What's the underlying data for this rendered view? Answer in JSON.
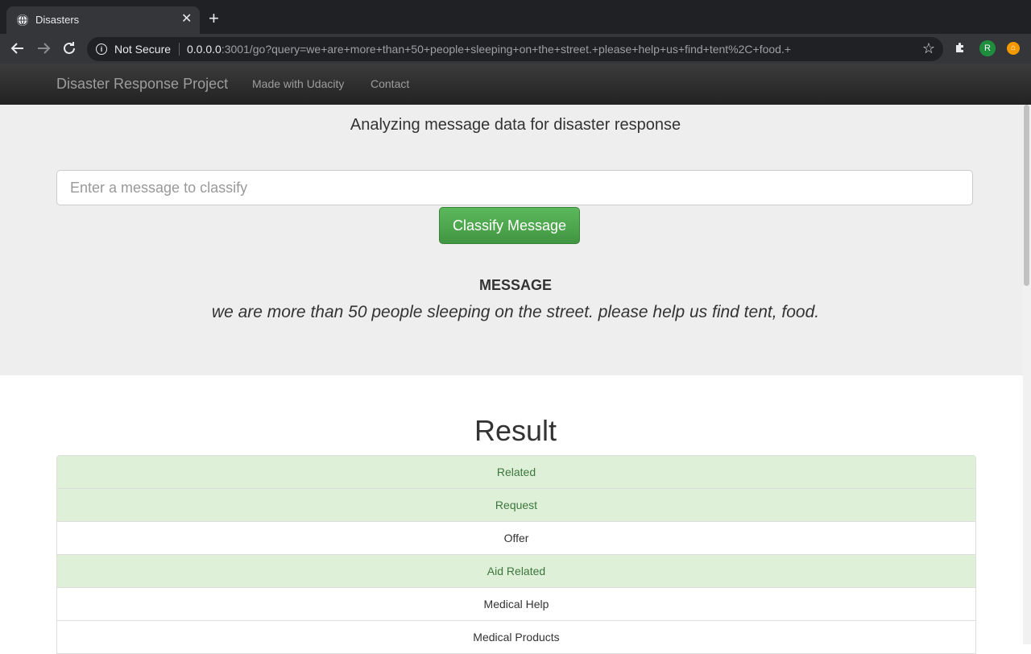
{
  "browser": {
    "tab_title": "Disasters",
    "tab_close": "✕",
    "new_tab": "+",
    "security_label": "Not Secure",
    "url_host": "0.0.0.0",
    "url_rest": ":3001/go?query=we+are+more+than+50+people+sleeping+on+the+street.+please+help+us+find+tent%2C+food.+",
    "profile_initial": "R",
    "icons": [
      "globe-icon",
      "back-icon",
      "forward-icon",
      "reload-icon",
      "info-icon",
      "star-icon",
      "extensions-icon",
      "profile-avatar",
      "extension-icon"
    ]
  },
  "navbar": {
    "brand": "Disaster Response Project",
    "links": [
      "Made with Udacity",
      "Contact"
    ]
  },
  "hero": {
    "subtitle": "Analyzing message data for disaster response",
    "input_placeholder": "Enter a message to classify",
    "input_value": "",
    "classify_label": "Classify Message",
    "message_heading": "MESSAGE",
    "message_text": "we are more than 50 people sleeping on the street. please help us find tent, food."
  },
  "result": {
    "title": "Result",
    "rows": [
      {
        "label": "Related",
        "active": true
      },
      {
        "label": "Request",
        "active": true
      },
      {
        "label": "Offer",
        "active": false
      },
      {
        "label": "Aid Related",
        "active": true
      },
      {
        "label": "Medical Help",
        "active": false
      },
      {
        "label": "Medical Products",
        "active": false
      }
    ]
  },
  "colors": {
    "active_row_bg": "#dff0d8",
    "active_row_text": "#3c763d",
    "button_green": "#5cb85c",
    "navbar_dark": "#222222",
    "jumbotron_bg": "#eeeeee"
  }
}
